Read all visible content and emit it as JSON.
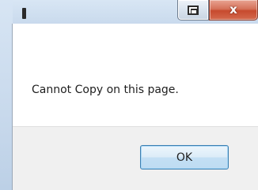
{
  "dialog": {
    "message": "Cannot Copy on this page.",
    "ok_label": "OK",
    "close_glyph": "x"
  },
  "icons": {
    "restore": "restore-icon",
    "close": "close-icon"
  },
  "colors": {
    "titlebar": "#c9daed",
    "close_button": "#c74a2e",
    "button_strip": "#f0f0f0",
    "ok_border": "#3c7fb1"
  }
}
